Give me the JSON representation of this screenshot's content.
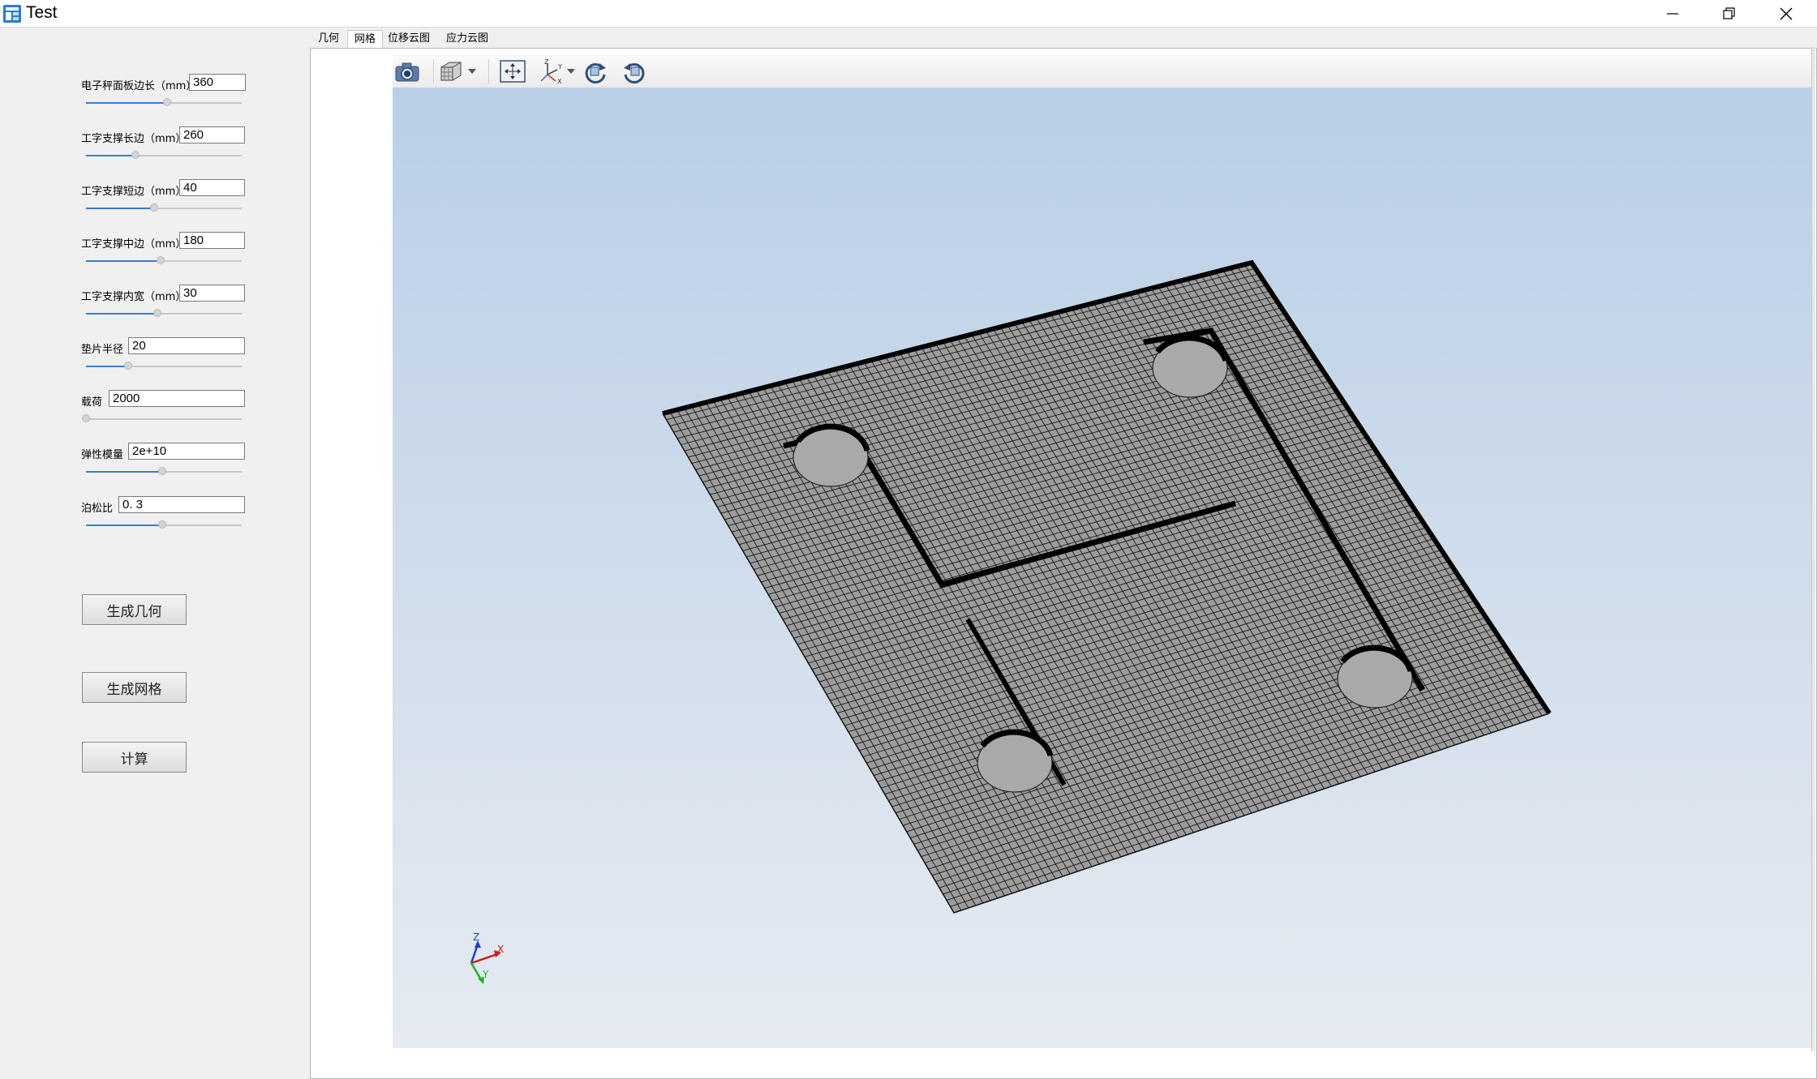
{
  "window": {
    "title": "Test",
    "controls": [
      "minimize",
      "restore",
      "close"
    ]
  },
  "params": [
    {
      "label": "电子秤面板边长（mm）",
      "value": "360",
      "slider_fraction": 0.52
    },
    {
      "label": "工字支撑长边（mm）",
      "value": "260",
      "slider_fraction": 0.32
    },
    {
      "label": "工字支撑短边（mm）",
      "value": "40",
      "slider_fraction": 0.44
    },
    {
      "label": "工字支撑中边（mm）",
      "value": "180",
      "slider_fraction": 0.48
    },
    {
      "label": "工字支撑内宽（mm）",
      "value": "30",
      "slider_fraction": 0.46
    },
    {
      "label": "垫片半径",
      "value": "20",
      "slider_fraction": 0.27
    },
    {
      "label": "载荷",
      "value": "2000",
      "slider_fraction": 0.0
    },
    {
      "label": "弹性模量",
      "value": "2e+10",
      "slider_fraction": 0.49
    },
    {
      "label": "泊松比",
      "value": "0. 3",
      "slider_fraction": 0.49
    }
  ],
  "buttons": {
    "generate_geometry": "生成几何",
    "generate_mesh": "生成网格",
    "compute": "计算"
  },
  "tabs": [
    {
      "label": "几何",
      "active": false
    },
    {
      "label": "网格",
      "active": true
    },
    {
      "label": "位移云图",
      "active": false
    },
    {
      "label": "应力云图",
      "active": false
    }
  ],
  "viewer_toolbar": [
    "camera-icon",
    "view-cube-icon",
    "fit-view-icon",
    "axes-icon",
    "rotate-cw-icon",
    "rotate-ccw-icon"
  ],
  "axes_triad": {
    "x": "X",
    "y": "Y",
    "z": "Z"
  },
  "colors": {
    "accent": "#3a7bd5",
    "viewport_top": "#b9cfe6",
    "viewport_bottom": "#e6ebf2",
    "mesh_fill": "#9a9a9a",
    "mesh_line": "#1a1a1a"
  }
}
